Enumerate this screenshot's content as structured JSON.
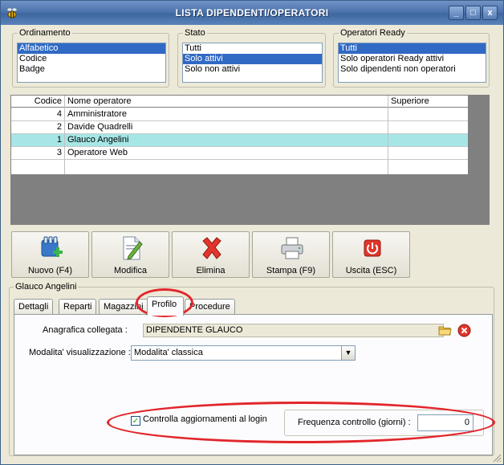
{
  "window": {
    "title": "LISTA DIPENDENTI/OPERATORI",
    "controls": {
      "minimize": "_",
      "maximize": "□",
      "close": "x"
    }
  },
  "ordinamento": {
    "label": "Ordinamento",
    "options": [
      "Alfabetico",
      "Codice",
      "Badge"
    ],
    "selected": 0
  },
  "stato": {
    "label": "Stato",
    "options": [
      "Tutti",
      "Solo attivi",
      "Solo non attivi"
    ],
    "selected": 1
  },
  "operatori_ready": {
    "label": "Operatori Ready",
    "options": [
      "Tutti",
      "Solo operatori Ready attivi",
      "Solo dipendenti non operatori"
    ],
    "selected": 0
  },
  "grid": {
    "columns": [
      "Codice",
      "Nome operatore",
      "Superiore"
    ],
    "rows": [
      {
        "code": "4",
        "name": "Amministratore",
        "sup": ""
      },
      {
        "code": "2",
        "name": "Davide Quadrelli",
        "sup": ""
      },
      {
        "code": "1",
        "name": "Glauco Angelini",
        "sup": ""
      },
      {
        "code": "3",
        "name": "Operatore Web",
        "sup": ""
      }
    ],
    "selected_row": 2
  },
  "toolbar": {
    "new": "Nuovo (F4)",
    "edit": "Modifica",
    "delete": "Elimina",
    "print": "Stampa (F9)",
    "exit": "Uscita (ESC)"
  },
  "detail": {
    "group_label": "Glauco Angelini",
    "tabs": [
      "Dettagli",
      "Reparti",
      "Magazzini",
      "Profilo",
      "Procedure"
    ],
    "active_tab": 3,
    "anagrafica_label": "Anagrafica collegata :",
    "anagrafica_value": "DIPENDENTE GLAUCO",
    "modalita_label": "Modalita' visualizzazione :",
    "modalita_value": "Modalita' classica",
    "check_label": "Controlla aggiornamenti al login",
    "check_checked": true,
    "check_mark": "✓",
    "freq_label": "Frequenza controllo (giorni) :",
    "freq_value": "0"
  },
  "colors": {
    "accent": "#316ac5",
    "selected_row": "#a6e6e6",
    "highlight": "#e2262b"
  }
}
